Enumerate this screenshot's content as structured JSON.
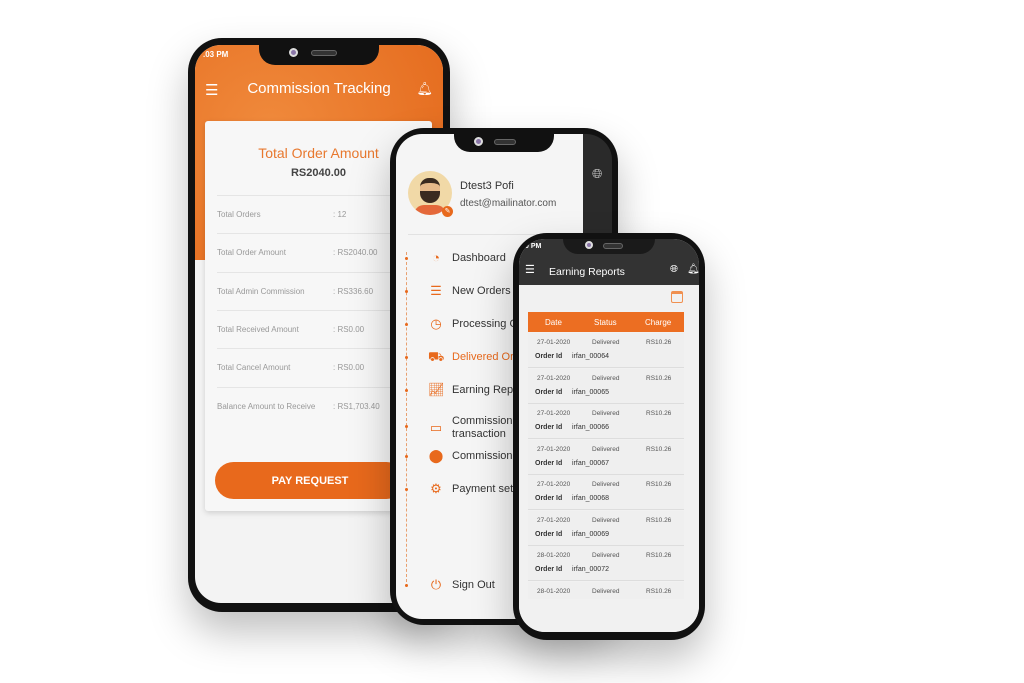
{
  "phone1": {
    "time": ".03 PM",
    "title": "Commission Tracking",
    "card_title": "Total Order Amount",
    "total": "RS2040.00",
    "rows": [
      {
        "label": "Total Orders",
        "value": ": 12"
      },
      {
        "label": "Total Order Amount",
        "value": ": RS2040.00"
      },
      {
        "label": "Total Admin Commission",
        "value": ": RS336.60"
      },
      {
        "label": "Total Received Amount",
        "value": ": RS0.00"
      },
      {
        "label": "Total Cancel Amount",
        "value": ": RS0.00"
      },
      {
        "label": "Balance Amount to Receive",
        "value": ": RS1,703.40"
      }
    ],
    "button": "PAY REQUEST"
  },
  "phone2": {
    "name": "Dtest3 Pofi",
    "email": "dtest@mailinator.com",
    "menu": [
      {
        "label": "Dashboard",
        "icon": "speedometer-icon"
      },
      {
        "label": "New Orders",
        "icon": "list-icon"
      },
      {
        "label": "Processing O",
        "icon": "clock-icon"
      },
      {
        "label": "Delivered Or",
        "icon": "truck-icon",
        "active": true
      },
      {
        "label": "Earning Rep",
        "icon": "chart-icon"
      },
      {
        "label": "Commission\ntransaction",
        "icon": "card-icon"
      },
      {
        "label": "Commission",
        "icon": "location-pin-icon"
      },
      {
        "label": "Payment set",
        "icon": "gear-dollar-icon"
      }
    ],
    "signout": "Sign Out"
  },
  "phone3": {
    "time": "0 PM",
    "title": "Earning Reports",
    "headers": [
      "Date",
      "Status",
      "Charge"
    ],
    "order_label": "Order Id",
    "rows": [
      {
        "date": "27-01-2020",
        "status": "Delivered",
        "charge": "RS10.26",
        "order": "irfan_00064"
      },
      {
        "date": "27-01-2020",
        "status": "Delivered",
        "charge": "RS10.26",
        "order": "irfan_00065"
      },
      {
        "date": "27-01-2020",
        "status": "Delivered",
        "charge": "RS10.26",
        "order": "irfan_00066"
      },
      {
        "date": "27-01-2020",
        "status": "Delivered",
        "charge": "RS10.26",
        "order": "irfan_00067"
      },
      {
        "date": "27-01-2020",
        "status": "Delivered",
        "charge": "RS10.26",
        "order": "irfan_00068"
      },
      {
        "date": "27-01-2020",
        "status": "Delivered",
        "charge": "RS10.26",
        "order": "irfan_00069"
      },
      {
        "date": "28-01-2020",
        "status": "Delivered",
        "charge": "RS10.26",
        "order": "irfan_00072"
      },
      {
        "date": "28-01-2020",
        "status": "Delivered",
        "charge": "RS10.26",
        "order": ""
      }
    ]
  },
  "colors": {
    "accent": "#e8691c",
    "dark_header": "#333333"
  }
}
